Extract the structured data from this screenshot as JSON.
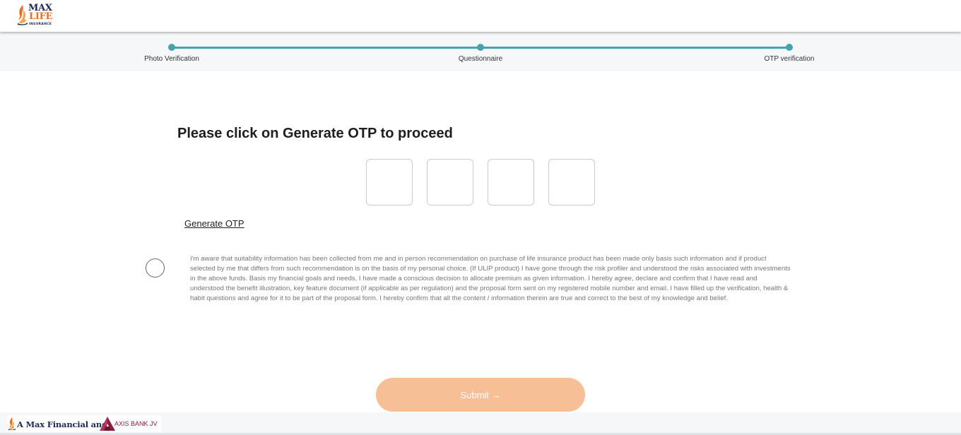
{
  "header": {
    "logo": {
      "line1": "MAX",
      "line2": "LIFE",
      "line3": "INSURANCE",
      "icon": "flame-logo-icon"
    }
  },
  "stepper": {
    "steps": [
      {
        "label": "Photo Verification"
      },
      {
        "label": "Questionnaire"
      },
      {
        "label": "OTP verification"
      }
    ],
    "accent_color": "#45a2ae"
  },
  "main": {
    "title": "Please click on Generate OTP to proceed",
    "otp_digits": [
      "",
      "",
      "",
      ""
    ],
    "generate_otp_label": "Generate OTP",
    "consent_text": "I'm aware that suitability information has been collected from me and in person recommendation on purchase of life insurance product has been made only basis such information and if product selected by me that differs from such recommendation is on the basis of my personal choice. (If ULIP product) I have gone through the risk profiler and understood the risks associated with investments in the above funds. Basis my financial goals and needs, I have made a conscious decision to allocate premium as given information. I hereby agree, declare and confirm that I have read and understood the benefit illustration, key feature document (if applicable as per regulation) and the proposal form sent on my registered mobile number and email. I have filled up the verification, health & habit questions and agree for it to be part of the proposal form. I hereby confirm that all the content / information therein are true and correct to the best of my knowledge and belief.",
    "consent_checked": false,
    "submit_label": "Submit →",
    "submit_color": "#f6bf96"
  },
  "footer": {
    "brand_text": "A Max Financial and",
    "partner_text": "AXIS BANK JV",
    "brand_color": "#1c2a5a",
    "partner_color": "#8c1d40"
  }
}
